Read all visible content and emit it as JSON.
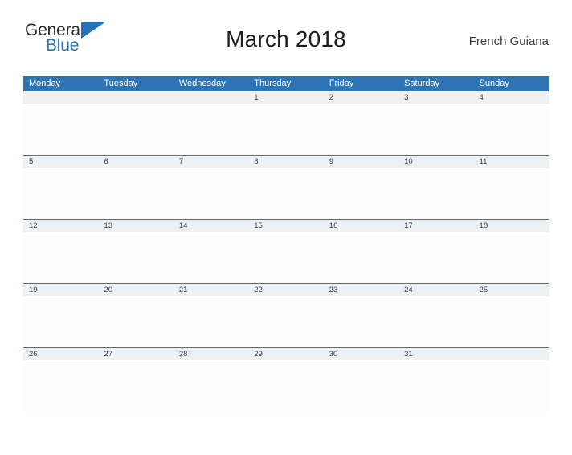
{
  "brand": {
    "logo_text_1": "General",
    "logo_text_2": "Blue",
    "logo_icon": "triangle-flag-icon",
    "color_primary": "#2473b8"
  },
  "header": {
    "title": "March 2018",
    "region": "French Guiana"
  },
  "calendar": {
    "header_bg": "#2d74b5",
    "date_strip_bg": "#f0f0f0",
    "weekdays": [
      "Monday",
      "Tuesday",
      "Wednesday",
      "Thursday",
      "Friday",
      "Saturday",
      "Sunday"
    ],
    "weeks": [
      [
        "",
        "",
        "",
        "1",
        "2",
        "3",
        "4"
      ],
      [
        "5",
        "6",
        "7",
        "8",
        "9",
        "10",
        "11"
      ],
      [
        "12",
        "13",
        "14",
        "15",
        "16",
        "17",
        "18"
      ],
      [
        "19",
        "20",
        "21",
        "22",
        "23",
        "24",
        "25"
      ],
      [
        "26",
        "27",
        "28",
        "29",
        "30",
        "31",
        ""
      ]
    ]
  }
}
